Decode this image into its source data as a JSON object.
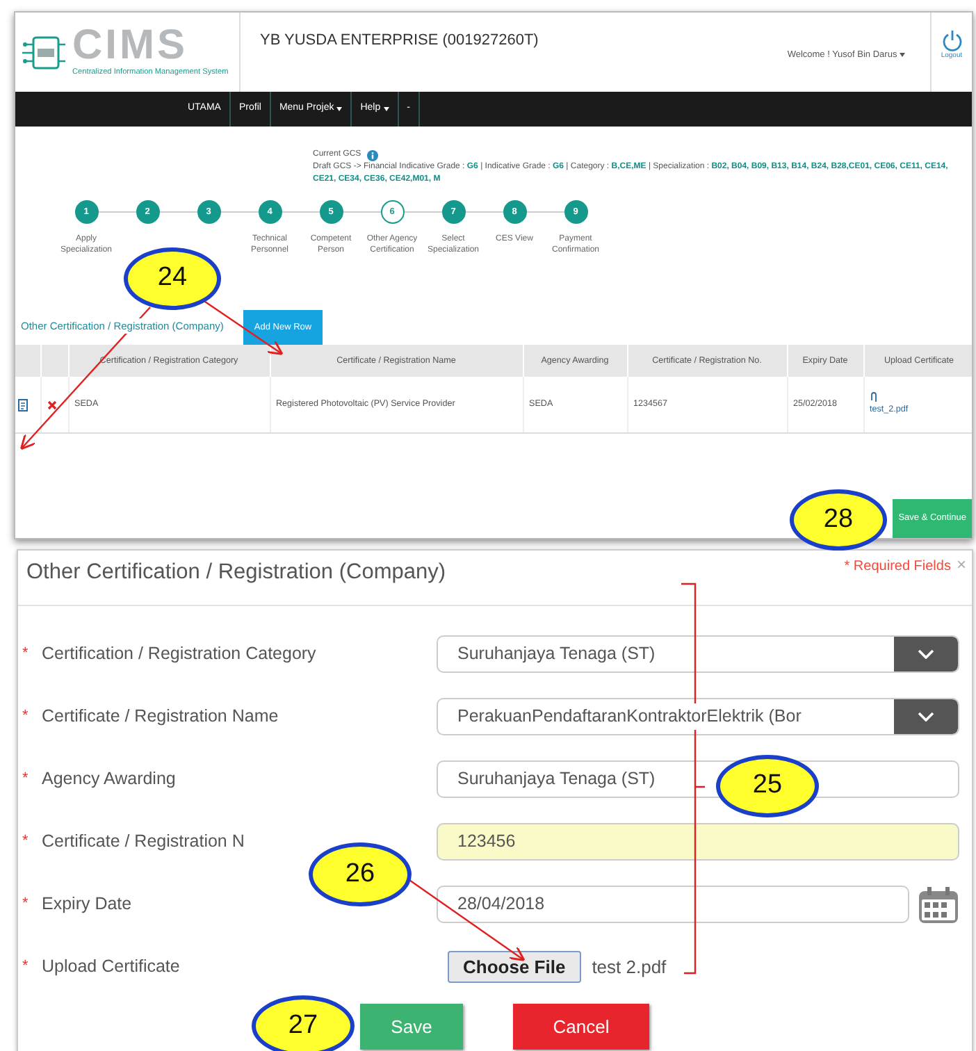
{
  "header": {
    "logo_title": "CIMS",
    "logo_subtitle": "Centralized Information Management System",
    "company": "YB YUSDA ENTERPRISE (001927260T)",
    "welcome": "Welcome ! Yusof Bin Darus",
    "logout": "Logout"
  },
  "nav": [
    {
      "label": "UTAMA",
      "dropdown": false
    },
    {
      "label": "Profil",
      "dropdown": false
    },
    {
      "label": "Menu Projek",
      "dropdown": true
    },
    {
      "label": "Help",
      "dropdown": true
    },
    {
      "label": "-",
      "dropdown": false
    }
  ],
  "gcs": {
    "current_label": "Current GCS",
    "draft": "Draft GCS -> Financial Indicative Grade : **G6** | Indicative Grade : **G6** | Category : **B,CE,ME** | Specialization : **B02, B04, B09, B13, B14, B24, B28,CE01, CE06, CE11, CE14, CE21, CE34, CE36, CE42,M01, M**"
  },
  "steps": [
    {
      "number": "1",
      "label": "Apply Specialization",
      "selected": false
    },
    {
      "number": "2",
      "selected": false
    },
    {
      "number": "3",
      "selected": false
    },
    {
      "number": "4",
      "label": "Technical Personnel",
      "selected": false
    },
    {
      "number": "5",
      "label": "Competent Person",
      "selected": false
    },
    {
      "number": "6",
      "label": "Other Agency Certification",
      "selected": true
    },
    {
      "number": "7",
      "label": "Select Specialization",
      "selected": false
    },
    {
      "number": "8",
      "label": "CES View",
      "selected": false
    },
    {
      "number": "9",
      "label": "Payment Confirmation",
      "selected": false
    }
  ],
  "section": {
    "title": "Other Certification / Registration (Company)",
    "add_button": "Add New Row"
  },
  "table": {
    "columns": [
      "Certification / Registration Category",
      "Certificate / Registration Name",
      "Agency Awarding",
      "Certificate / Registration No.",
      "Expiry Date",
      "Upload Certificate"
    ],
    "rows": [
      {
        "cells": [
          "SEDA",
          "Registered Photovoltaic (PV) Service Provider",
          "SEDA",
          "1234567",
          "25/02/2018"
        ],
        "file": "test_2.pdf"
      }
    ]
  },
  "save_continue": "Save & Continue",
  "modal": {
    "title": "Other Certification / Registration (Company)",
    "required_note": "* Required Fields",
    "close": "×",
    "fields": [
      {
        "mark": "*",
        "label": "Certification / Registration Category",
        "kind": "select",
        "value": "Suruhanjaya Tenaga (ST)"
      },
      {
        "mark": "*",
        "label": "Certificate / Registration Name",
        "kind": "select",
        "value": "PerakuanPendaftaranKontraktorElektrik (Bor"
      },
      {
        "mark": "*",
        "label": "Agency Awarding",
        "kind": "text",
        "value": "Suruhanjaya Tenaga (ST)"
      },
      {
        "mark": "*",
        "label": "Certificate / Registration N",
        "kind": "text",
        "value": "123456",
        "highlighted": true
      },
      {
        "mark": "*",
        "label": "Expiry Date",
        "kind": "date",
        "value": "28/04/2018"
      },
      {
        "mark": "*",
        "label": "Upload Certificate",
        "kind": "file",
        "button": "Choose File",
        "value": "test 2.pdf"
      }
    ],
    "buttons": [
      {
        "label": "Save",
        "kind": "save"
      },
      {
        "label": "Cancel",
        "kind": "cancel"
      }
    ]
  },
  "callouts": [
    {
      "number": "24"
    },
    {
      "number": "28"
    },
    {
      "number": "25"
    },
    {
      "number": "26"
    },
    {
      "number": "27"
    }
  ]
}
